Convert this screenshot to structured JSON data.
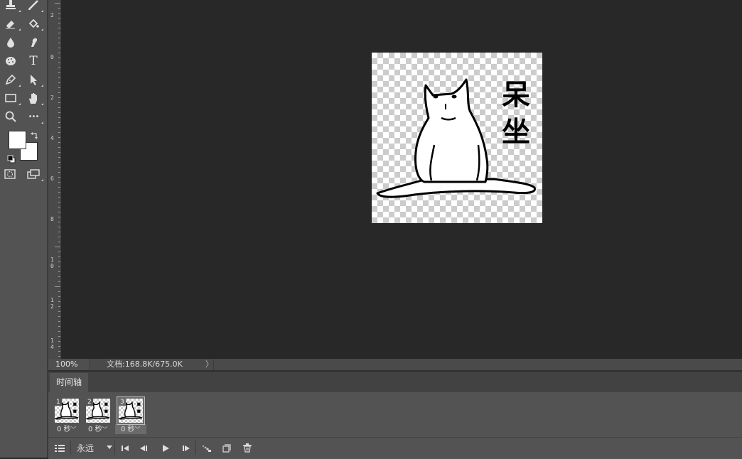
{
  "toolbar": {
    "tools": [
      {
        "name": "stamp-tool",
        "icon": "clone-stamp-icon"
      },
      {
        "name": "history-brush-tool",
        "icon": "history-brush-icon"
      },
      {
        "name": "eraser-tool",
        "icon": "eraser-icon"
      },
      {
        "name": "paint-bucket-tool",
        "icon": "paint-bucket-icon"
      },
      {
        "name": "blur-tool",
        "icon": "blur-drop-icon"
      },
      {
        "name": "smudge-tool",
        "icon": "smudge-finger-icon"
      },
      {
        "name": "sponge-tool",
        "icon": "sponge-icon"
      },
      {
        "name": "type-tool",
        "icon": "type-icon",
        "label": "T"
      },
      {
        "name": "pen-tool",
        "icon": "pen-icon"
      },
      {
        "name": "path-selection-tool",
        "icon": "arrow-pointer-icon"
      },
      {
        "name": "rectangle-tool",
        "icon": "rectangle-icon"
      },
      {
        "name": "hand-tool",
        "icon": "hand-icon"
      },
      {
        "name": "zoom-tool",
        "icon": "magnifier-icon"
      },
      {
        "name": "more-tools",
        "icon": "ellipsis-icon",
        "label": "•••"
      }
    ],
    "foreground_color": "#ffffff",
    "background_color": "#ffffff"
  },
  "ruler": {
    "labels": [
      "2",
      "0",
      "2",
      "4",
      "6",
      "8",
      "1\n0",
      "1\n2",
      "1\n4"
    ]
  },
  "canvas": {
    "text": "呆坐"
  },
  "status": {
    "zoom": "100%",
    "doc_info": "文档:168.8K/675.0K",
    "arrow": "〉"
  },
  "panel": {
    "tab": "时间轴",
    "frames": [
      {
        "num": "1",
        "delay": "0 秒",
        "selected": false
      },
      {
        "num": "2",
        "delay": "0 秒",
        "selected": false
      },
      {
        "num": "3",
        "delay": "0 秒",
        "selected": true
      }
    ],
    "loop": "永远"
  },
  "colors": {
    "toolbar_bg": "#535353",
    "workspace_bg": "#282828",
    "panel_bg": "#535353",
    "header_bg": "#424242"
  }
}
